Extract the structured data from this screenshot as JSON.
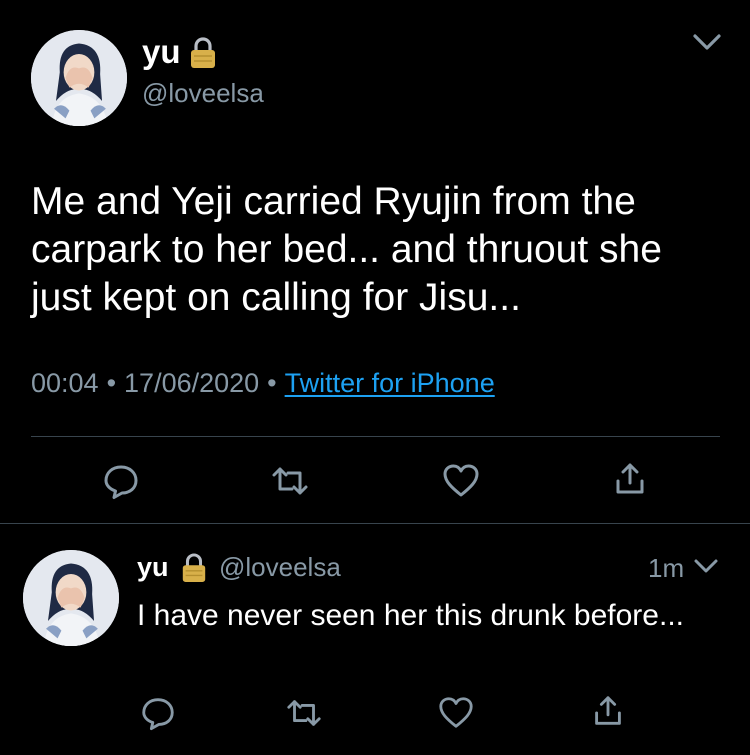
{
  "colors": {
    "background": "#000000",
    "primary_text": "#ffffff",
    "secondary_text": "#8899a6",
    "link": "#1da1f2",
    "divider": "#38444d",
    "lock": "#d8b04a"
  },
  "icons": {
    "avatar": "avatar-image",
    "lock": "lock-icon",
    "chevron": "chevron-down-icon",
    "reply": "reply-icon",
    "retweet": "retweet-icon",
    "like": "heart-icon",
    "share": "share-icon"
  },
  "main_tweet": {
    "display_name": "yu",
    "handle": "@loveelsa",
    "text": "Me and Yeji carried Ryujin from the carpark to her bed... and thruout she just kept on calling for Jisu...",
    "time": "00:04",
    "date": "17/06/2020",
    "source": "Twitter for iPhone",
    "separator": "•"
  },
  "reply_tweet": {
    "display_name": "yu",
    "handle": "@loveelsa",
    "relative_time": "1m",
    "text": "I have never seen her this drunk before..."
  }
}
